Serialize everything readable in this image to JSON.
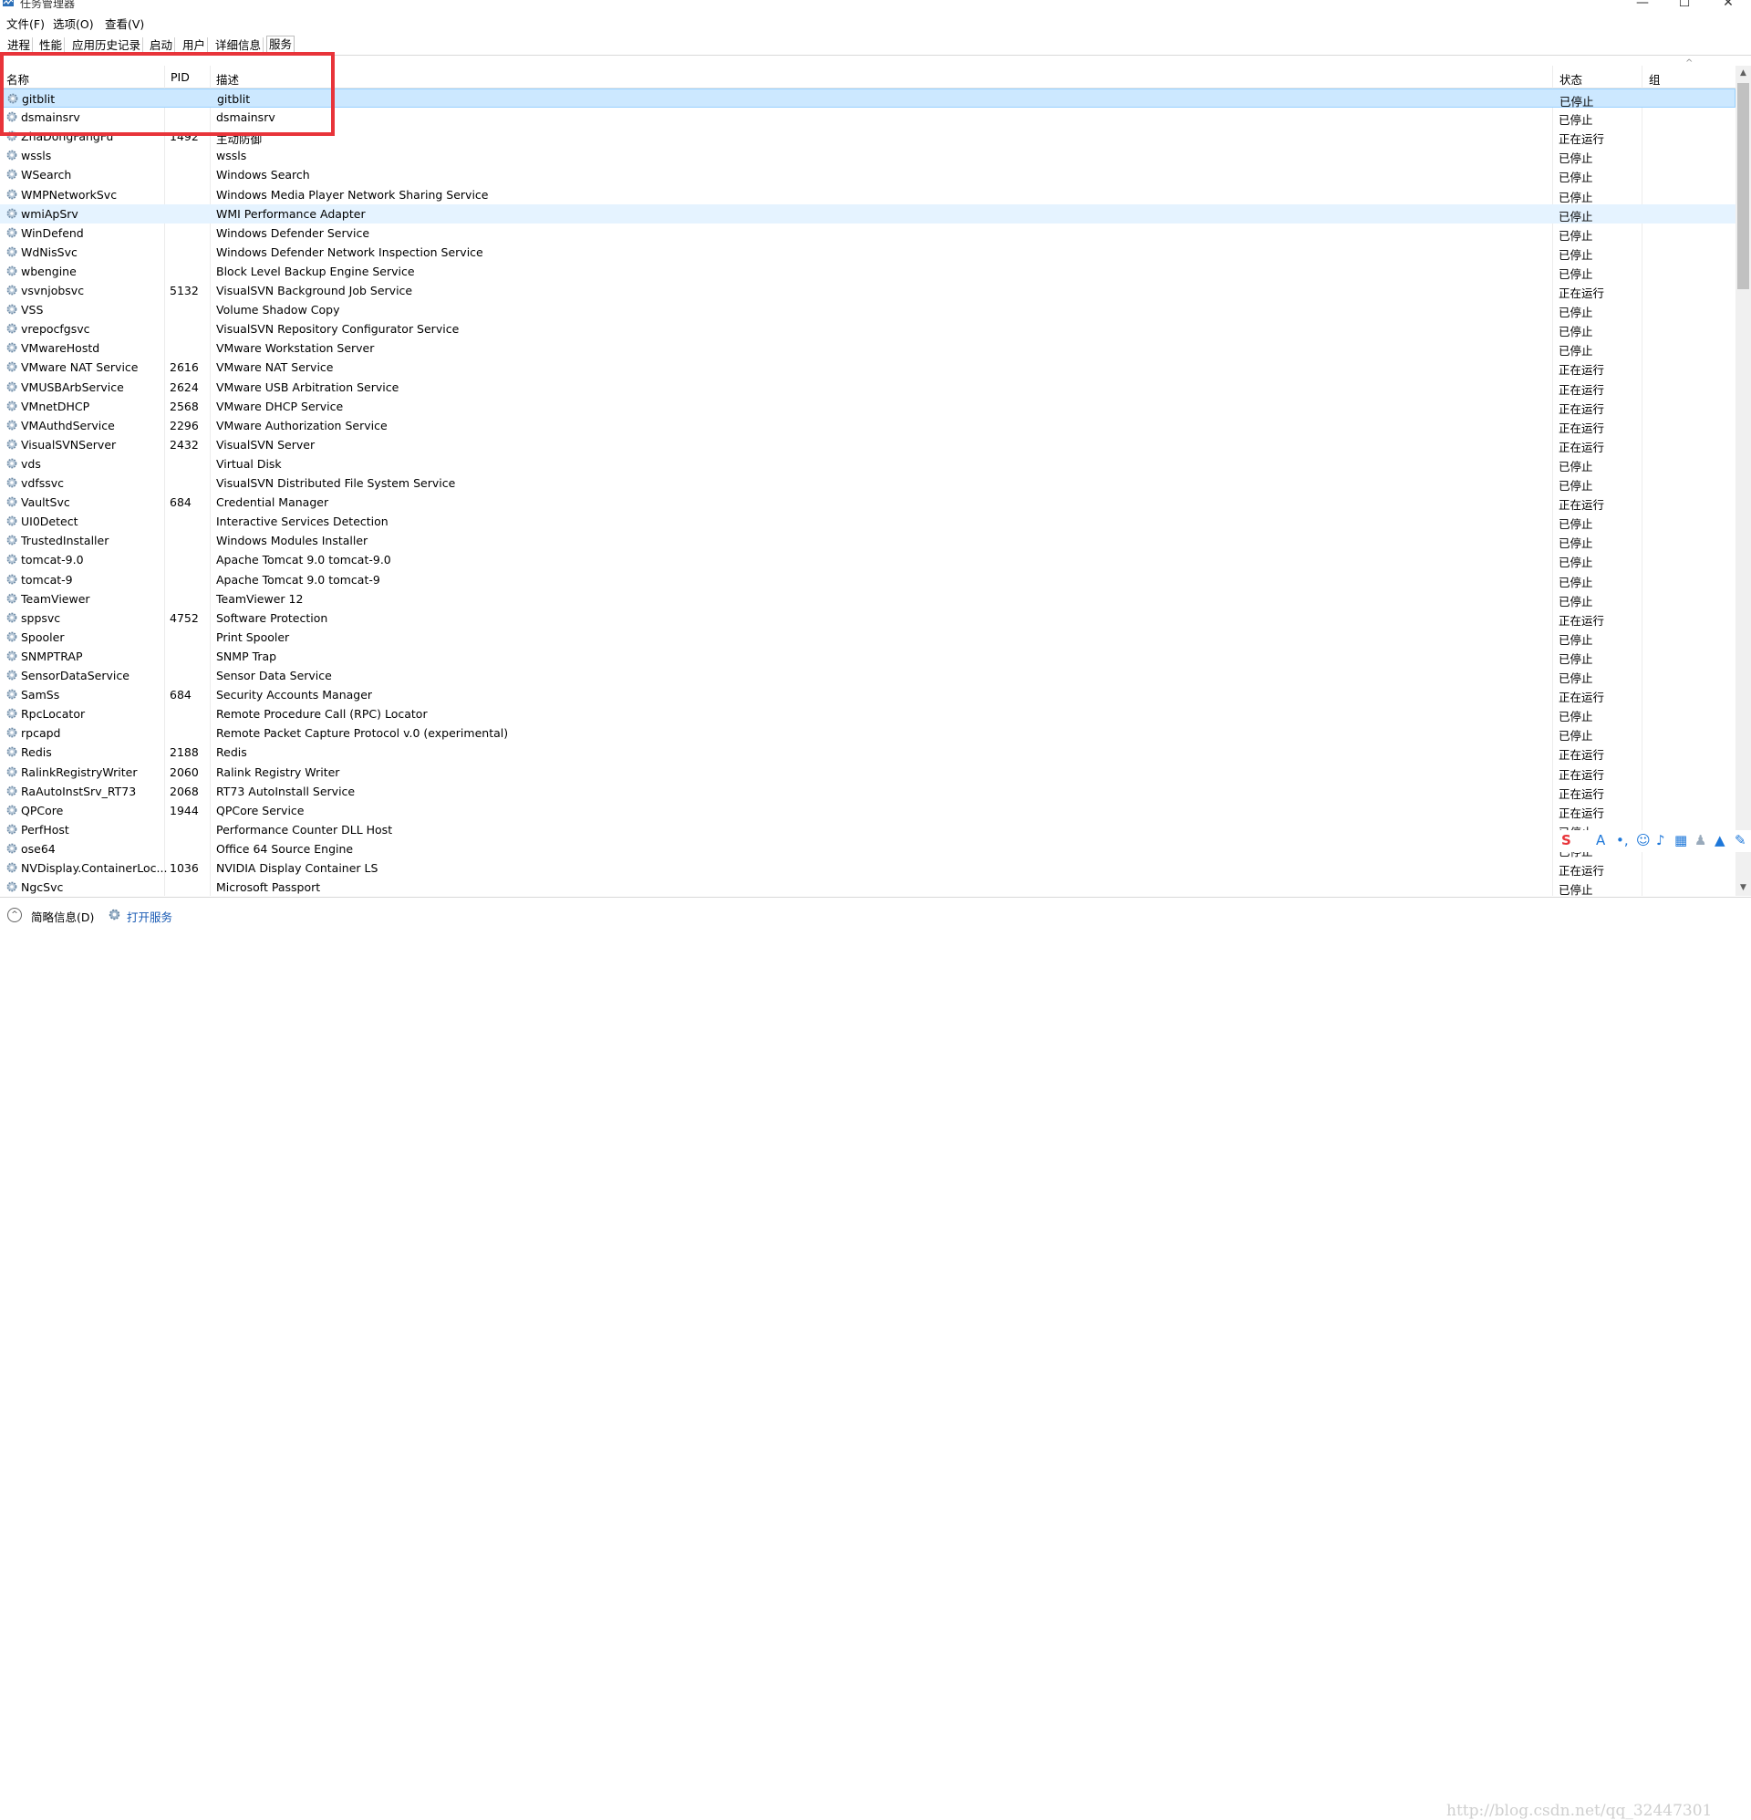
{
  "window": {
    "title": "任务管理器",
    "minimize": "—",
    "maximize": "☐",
    "close": "✕"
  },
  "menu": [
    "文件(F)",
    "选项(O)",
    "查看(V)"
  ],
  "tabs": [
    "进程",
    "性能",
    "应用历史记录",
    "启动",
    "用户",
    "详细信息",
    "服务"
  ],
  "active_tab": "服务",
  "columns": {
    "name": "名称",
    "pid": "PID",
    "desc": "描述",
    "status": "状态",
    "group": "组"
  },
  "services": [
    {
      "name": "gitblit",
      "pid": "",
      "desc": "gitblit",
      "status": "已停止"
    },
    {
      "name": "dsmainsrv",
      "pid": "",
      "desc": "dsmainsrv",
      "status": "已停止"
    },
    {
      "name": "ZhaDongFangFu",
      "pid": "1492",
      "desc": "主动防御",
      "status": "正在运行"
    },
    {
      "name": "wssls",
      "pid": "",
      "desc": "wssls",
      "status": "已停止"
    },
    {
      "name": "WSearch",
      "pid": "",
      "desc": "Windows Search",
      "status": "已停止"
    },
    {
      "name": "WMPNetworkSvc",
      "pid": "",
      "desc": "Windows Media Player Network Sharing Service",
      "status": "已停止"
    },
    {
      "name": "wmiApSrv",
      "pid": "",
      "desc": "WMI Performance Adapter",
      "status": "已停止"
    },
    {
      "name": "WinDefend",
      "pid": "",
      "desc": "Windows Defender Service",
      "status": "已停止"
    },
    {
      "name": "WdNisSvc",
      "pid": "",
      "desc": "Windows Defender Network Inspection Service",
      "status": "已停止"
    },
    {
      "name": "wbengine",
      "pid": "",
      "desc": "Block Level Backup Engine Service",
      "status": "已停止"
    },
    {
      "name": "vsvnjobsvc",
      "pid": "5132",
      "desc": "VisualSVN Background Job Service",
      "status": "正在运行"
    },
    {
      "name": "VSS",
      "pid": "",
      "desc": "Volume Shadow Copy",
      "status": "已停止"
    },
    {
      "name": "vrepocfgsvc",
      "pid": "",
      "desc": "VisualSVN Repository Configurator Service",
      "status": "已停止"
    },
    {
      "name": "VMwareHostd",
      "pid": "",
      "desc": "VMware Workstation Server",
      "status": "已停止"
    },
    {
      "name": "VMware NAT Service",
      "pid": "2616",
      "desc": "VMware NAT Service",
      "status": "正在运行"
    },
    {
      "name": "VMUSBArbService",
      "pid": "2624",
      "desc": "VMware USB Arbitration Service",
      "status": "正在运行"
    },
    {
      "name": "VMnetDHCP",
      "pid": "2568",
      "desc": "VMware DHCP Service",
      "status": "正在运行"
    },
    {
      "name": "VMAuthdService",
      "pid": "2296",
      "desc": "VMware Authorization Service",
      "status": "正在运行"
    },
    {
      "name": "VisualSVNServer",
      "pid": "2432",
      "desc": "VisualSVN Server",
      "status": "正在运行"
    },
    {
      "name": "vds",
      "pid": "",
      "desc": "Virtual Disk",
      "status": "已停止"
    },
    {
      "name": "vdfssvc",
      "pid": "",
      "desc": "VisualSVN Distributed File System Service",
      "status": "已停止"
    },
    {
      "name": "VaultSvc",
      "pid": "684",
      "desc": "Credential Manager",
      "status": "正在运行"
    },
    {
      "name": "UI0Detect",
      "pid": "",
      "desc": "Interactive Services Detection",
      "status": "已停止"
    },
    {
      "name": "TrustedInstaller",
      "pid": "",
      "desc": "Windows Modules Installer",
      "status": "已停止"
    },
    {
      "name": "tomcat-9.0",
      "pid": "",
      "desc": "Apache Tomcat 9.0 tomcat-9.0",
      "status": "已停止"
    },
    {
      "name": "tomcat-9",
      "pid": "",
      "desc": "Apache Tomcat 9.0 tomcat-9",
      "status": "已停止"
    },
    {
      "name": "TeamViewer",
      "pid": "",
      "desc": "TeamViewer 12",
      "status": "已停止"
    },
    {
      "name": "sppsvc",
      "pid": "4752",
      "desc": "Software Protection",
      "status": "正在运行"
    },
    {
      "name": "Spooler",
      "pid": "",
      "desc": "Print Spooler",
      "status": "已停止"
    },
    {
      "name": "SNMPTRAP",
      "pid": "",
      "desc": "SNMP Trap",
      "status": "已停止"
    },
    {
      "name": "SensorDataService",
      "pid": "",
      "desc": "Sensor Data Service",
      "status": "已停止"
    },
    {
      "name": "SamSs",
      "pid": "684",
      "desc": "Security Accounts Manager",
      "status": "正在运行"
    },
    {
      "name": "RpcLocator",
      "pid": "",
      "desc": "Remote Procedure Call (RPC) Locator",
      "status": "已停止"
    },
    {
      "name": "rpcapd",
      "pid": "",
      "desc": "Remote Packet Capture Protocol v.0 (experimental)",
      "status": "已停止"
    },
    {
      "name": "Redis",
      "pid": "2188",
      "desc": "Redis",
      "status": "正在运行"
    },
    {
      "name": "RalinkRegistryWriter",
      "pid": "2060",
      "desc": "Ralink Registry Writer",
      "status": "正在运行"
    },
    {
      "name": "RaAutoInstSrv_RT73",
      "pid": "2068",
      "desc": "RT73 AutoInstall Service",
      "status": "正在运行"
    },
    {
      "name": "QPCore",
      "pid": "1944",
      "desc": "QPCore Service",
      "status": "正在运行"
    },
    {
      "name": "PerfHost",
      "pid": "",
      "desc": "Performance Counter DLL Host",
      "status": "已停止"
    },
    {
      "name": "ose64",
      "pid": "",
      "desc": "Office 64 Source Engine",
      "status": "已停止"
    },
    {
      "name": "NVDisplay.ContainerLoc...",
      "pid": "1036",
      "desc": "NVIDIA Display Container LS",
      "status": "正在运行"
    },
    {
      "name": "NgcSvc",
      "pid": "",
      "desc": "Microsoft Passport",
      "status": "已停止"
    }
  ],
  "footer": {
    "summary": "简略信息(D)",
    "open_services": "打开服务"
  },
  "watermark": "http://blog.csdn.net/qq_32447301",
  "colors": {
    "selection": "#cce8ff",
    "highlight_box": "#e8343a",
    "link": "#1a5bb4"
  }
}
